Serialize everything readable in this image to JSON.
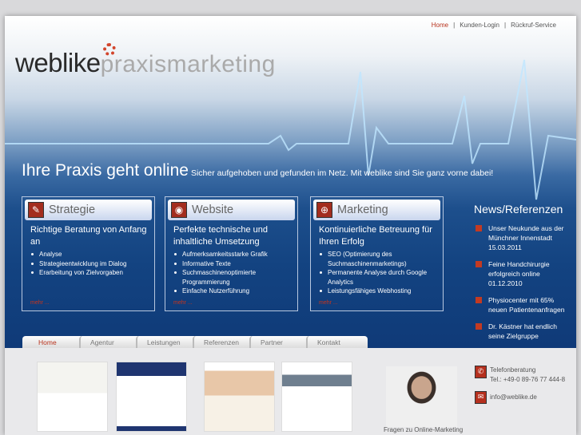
{
  "topnav": {
    "items": [
      "Home",
      "Kunden-Login",
      "Rückruf-Service"
    ],
    "separator": "|"
  },
  "logo": {
    "brand": "weblike",
    "suffix": "praxismarketing"
  },
  "headline": {
    "title": "Ihre Praxis geht online",
    "subtitle": "Sicher aufgehoben und gefunden im Netz. Mit weblike sind Sie ganz vorne dabei!"
  },
  "boxes": [
    {
      "title": "Strategie",
      "subtitle": "Richtige Beratung von Anfang an",
      "items": [
        "Analyse",
        "Strategieentwicklung im Dialog",
        "Erarbeitung von Zielvorgaben"
      ],
      "more": "mehr ..."
    },
    {
      "title": "Website",
      "subtitle": "Perfekte technische und inhaltliche Umsetzung",
      "items": [
        "Aufmerksamkeitsstarke Grafik",
        "Informative Texte",
        "Suchmaschinenoptimierte Programmierung",
        "Einfache Nutzerführung"
      ],
      "more": "mehr ..."
    },
    {
      "title": "Marketing",
      "subtitle": "Kontinuierliche Betreuung für Ihren Erfolg",
      "items": [
        "SEO (Optimierung des Suchmaschinenmarketings)",
        "Permanente Analyse durch Google Analytics",
        "Leistungsfähiges Webhosting"
      ],
      "more": "mehr ..."
    }
  ],
  "news": {
    "title": "News/Referenzen",
    "items": [
      "Unser Neukunde aus der Münchner Innenstadt 15.03.2011",
      "Feine Handchirurgie erfolgreich online 01.12.2010",
      "Physiocenter mit 65% neuen Patientenanfragen",
      "Dr. Kästner hat endlich seine Zielgruppe"
    ]
  },
  "tabs": [
    "Home",
    "Agentur",
    "Leistungen",
    "Referenzen",
    "Partner",
    "Kontakt"
  ],
  "contact": {
    "caption": "Fragen zu Online-Marketing",
    "phone_label": "Telefonberatung",
    "phone": "Tel.: +49-0 89-76 77 444-8",
    "email": "info@weblike.de"
  },
  "colors": {
    "accent": "#b8321c",
    "blue": "#134381"
  }
}
